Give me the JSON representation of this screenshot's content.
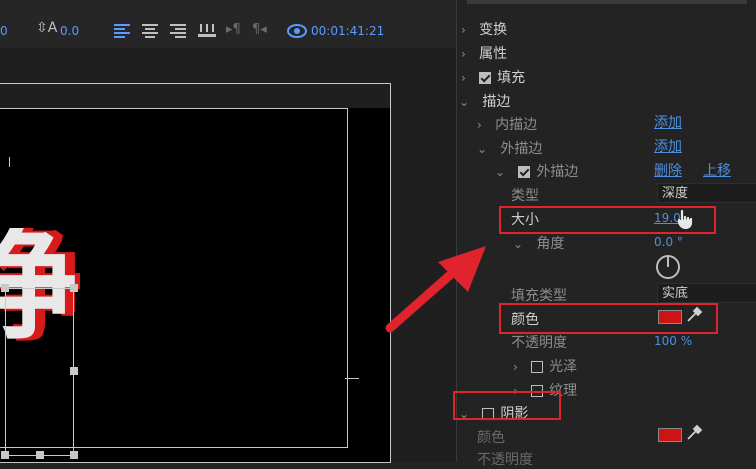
{
  "toolbar": {
    "value_left": "0",
    "tracking_value": "0.0",
    "timecode": "00:01:41:21"
  },
  "canvas": {
    "char": "净"
  },
  "panel": {
    "transform": "变换",
    "attributes": "属性",
    "fill": "填充",
    "stroke": "描边",
    "inner_stroke": "内描边",
    "add_inner": "添加",
    "outer_stroke": "外描边",
    "add_outer": "添加",
    "outer_stroke_item": "外描边",
    "delete": "删除",
    "move_up": "上移",
    "type_label": "类型",
    "type_value": "深度",
    "size_label": "大小",
    "size_value": "19.0",
    "angle_label": "角度",
    "angle_value": "0.0 °",
    "fill_type_label": "填充类型",
    "fill_type_value": "实底",
    "color_label": "颜色",
    "opacity_label": "不透明度",
    "opacity_value": "100 %",
    "gloss": "光泽",
    "texture": "纹理",
    "shadow": "阴影",
    "shadow_color_label": "颜色",
    "shadow_opacity_label": "不透明度"
  },
  "colors": {
    "stroke_color": "#cc1414",
    "shadow_color": "#cc1414",
    "annotation": "#e0232d"
  }
}
